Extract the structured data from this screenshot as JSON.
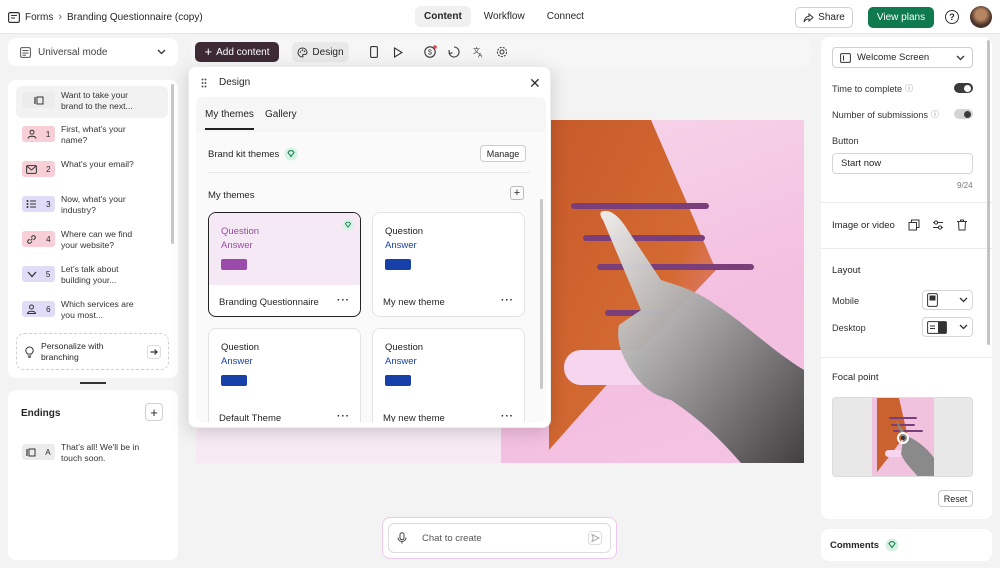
{
  "topbar": {
    "breadcrumb_root": "Forms",
    "form_title": "Branding Questionnaire (copy)",
    "tabs": [
      "Content",
      "Workflow",
      "Connect"
    ],
    "active_tab": "Content",
    "share_label": "Share",
    "plans_label": "View plans",
    "help_label": "?"
  },
  "left": {
    "mode_label": "Universal mode",
    "questions": [
      {
        "num": "",
        "text": "Want to take your brand to the next...",
        "icon": "welcome-screen-icon",
        "color": "#ececec"
      },
      {
        "num": "1",
        "text": "First, what's your name?",
        "icon": "contact-icon",
        "color": "#f8cfd7"
      },
      {
        "num": "2",
        "text": "What's your email?",
        "icon": "email-icon",
        "color": "#f8cfd7"
      },
      {
        "num": "3",
        "text": "Now, what's your industry?",
        "icon": "list-icon",
        "color": "#e0dcf7"
      },
      {
        "num": "4",
        "text": "Where can we find your website?",
        "icon": "link-icon",
        "color": "#f8cfd7"
      },
      {
        "num": "5",
        "text": "Let's talk about building your...",
        "icon": "dropdown-icon",
        "color": "#e0dcf7"
      },
      {
        "num": "6",
        "text": "Which services are you most...",
        "icon": "people-icon",
        "color": "#e0dcf7"
      }
    ],
    "personalize_label": "Personalize with branching",
    "endings_title": "Endings",
    "endings": [
      {
        "letter": "A",
        "text": "That's all! We'll be in touch soon.",
        "color": "#ececec"
      }
    ]
  },
  "toolbar": {
    "add_label": "Add content",
    "design_label": "Design"
  },
  "design": {
    "title": "Design",
    "tabs": [
      "My themes",
      "Gallery"
    ],
    "brand_kit_label": "Brand kit themes",
    "manage_label": "Manage",
    "my_themes_label": "My themes",
    "themes": [
      {
        "name": "Branding Questionnaire",
        "q": "Question",
        "a": "Answer",
        "bg": "#f6e9f6",
        "q_color": "#8e4f9a",
        "swatch": "#9d4bab",
        "selected": true,
        "brand": true
      },
      {
        "name": "My new theme",
        "q": "Question",
        "a": "Answer",
        "bg": "#ffffff",
        "q_color": "#1d1d1d",
        "swatch": "#1740a8",
        "selected": false,
        "brand": false
      },
      {
        "name": "Default Theme",
        "q": "Question",
        "a": "Answer",
        "bg": "#ffffff",
        "q_color": "#1d1d1d",
        "swatch": "#1740a8",
        "selected": false,
        "brand": false
      },
      {
        "name": "My new theme",
        "q": "Question",
        "a": "Answer",
        "bg": "#ffffff",
        "q_color": "#1d1d1d",
        "swatch": "#1740a8",
        "selected": false,
        "brand": false
      }
    ]
  },
  "right": {
    "screen_select": "Welcome Screen",
    "time_label": "Time to complete",
    "time_on": true,
    "subs_label": "Number of submissions",
    "subs_on": false,
    "button_label": "Button",
    "button_value": "Start now",
    "char_count": "9/24",
    "image_label": "Image or video",
    "layout_label": "Layout",
    "mobile_label": "Mobile",
    "desktop_label": "Desktop",
    "focal_label": "Focal point",
    "reset_label": "Reset",
    "comments_label": "Comments"
  },
  "chat": {
    "placeholder": "Chat to create"
  },
  "colors": {
    "accent_green": "#0e7a4d",
    "add_btn": "#3d2a35",
    "canvas_bg": "#f7eaf5"
  }
}
